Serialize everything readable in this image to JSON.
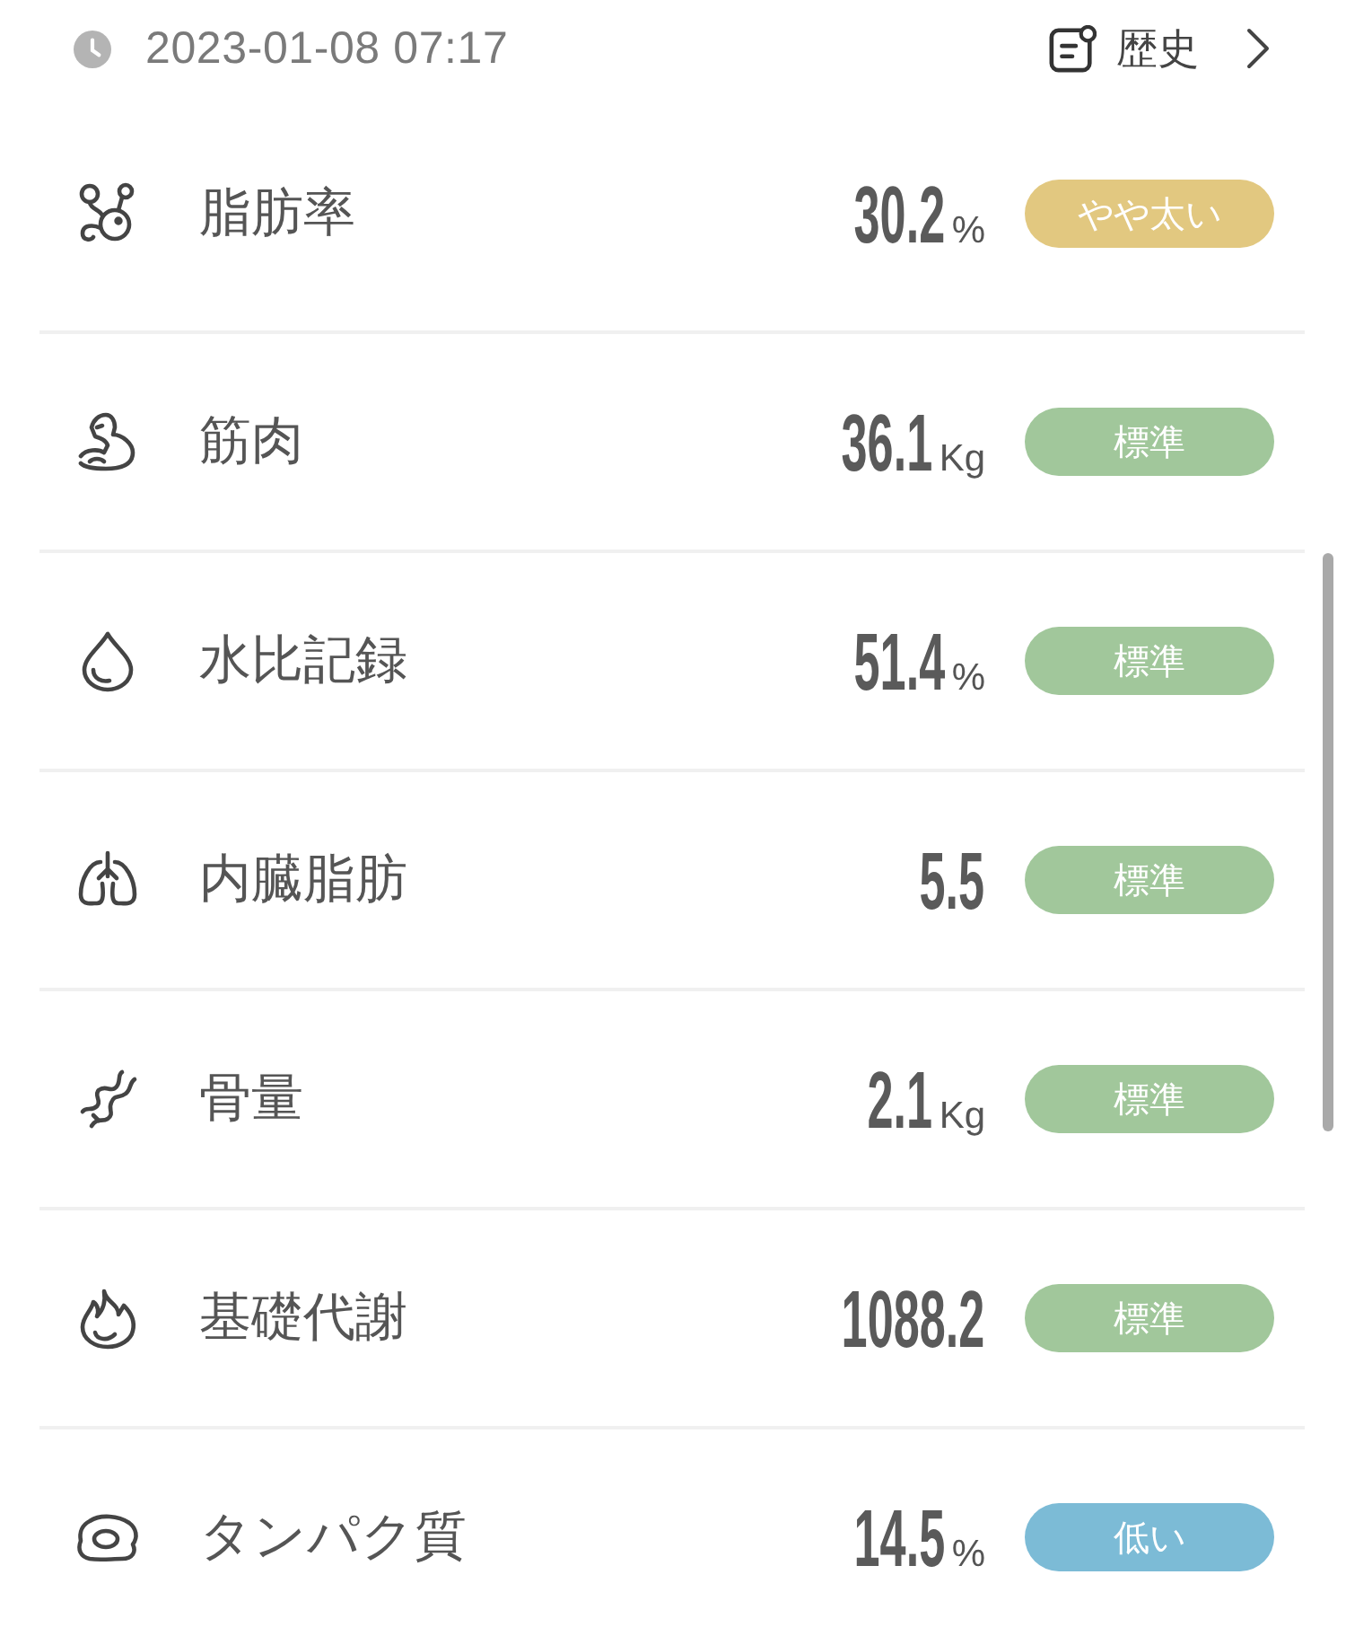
{
  "header": {
    "datetime": "2023-01-08 07:17",
    "history_link": {
      "label": "歴史"
    }
  },
  "metrics": [
    {
      "kind": "fat",
      "label": "脂肪率",
      "value": "30.2",
      "unit": "%",
      "status": {
        "label": "やや太い",
        "color": "#e2c880"
      }
    },
    {
      "kind": "muscle",
      "label": "筋肉",
      "value": "36.1",
      "unit": "Kg",
      "status": {
        "label": "標準",
        "color": "#a1c79b"
      }
    },
    {
      "kind": "water",
      "label": "水比記録",
      "value": "51.4",
      "unit": "%",
      "status": {
        "label": "標準",
        "color": "#a1c79b"
      }
    },
    {
      "kind": "visceral",
      "label": "内臓脂肪",
      "value": "5.5",
      "status": {
        "label": "標準",
        "color": "#a1c79b"
      }
    },
    {
      "kind": "bone",
      "label": "骨量",
      "value": "2.1",
      "unit": "Kg",
      "status": {
        "label": "標準",
        "color": "#a1c79b"
      }
    },
    {
      "kind": "bmr",
      "label": "基礎代謝",
      "value": "1088.2",
      "status": {
        "label": "標準",
        "color": "#a1c79b"
      }
    },
    {
      "kind": "protein",
      "label": "タンパク質",
      "value": "14.5",
      "unit": "%",
      "status": {
        "label": "低い",
        "color": "#7cbbd6"
      }
    }
  ]
}
